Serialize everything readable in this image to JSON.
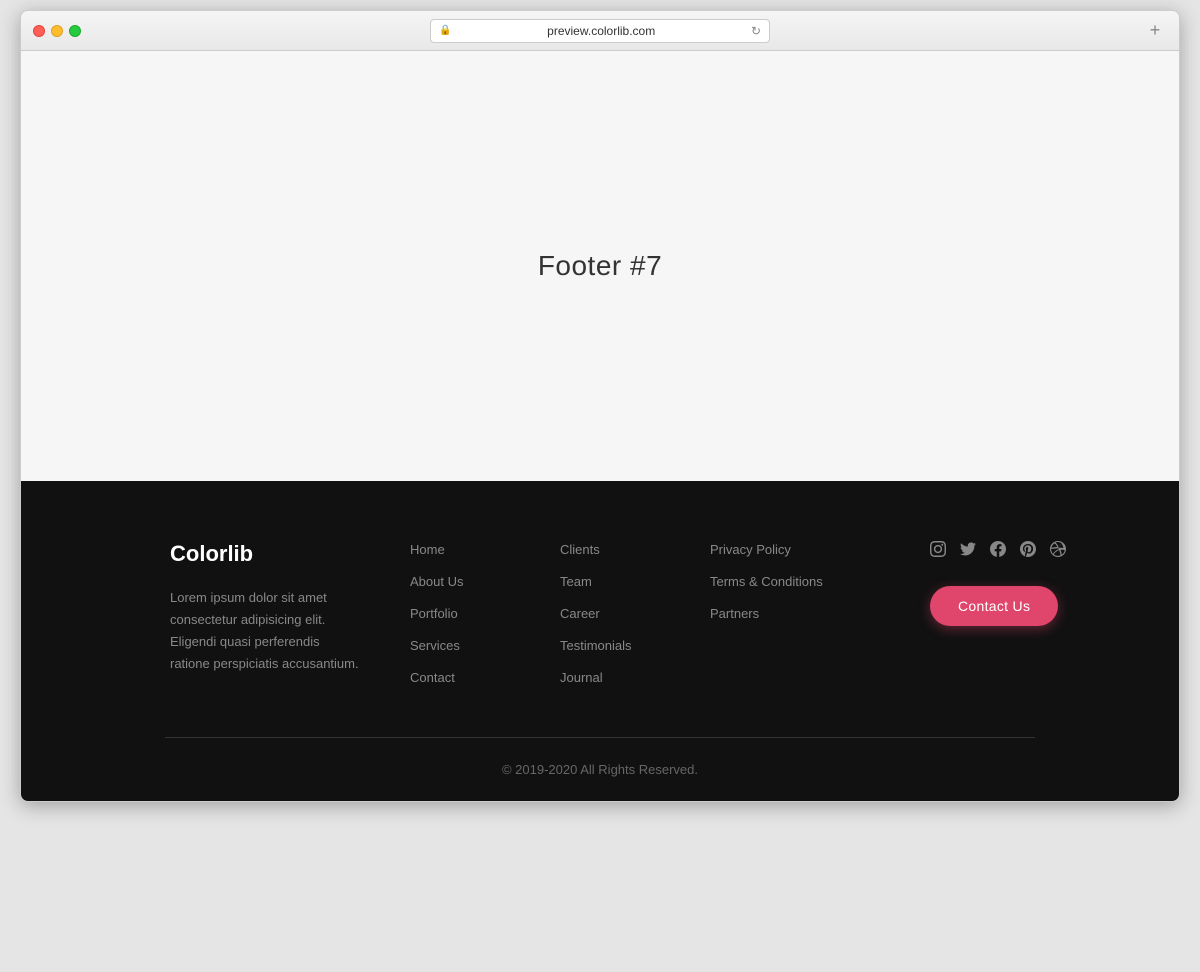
{
  "browser": {
    "url": "preview.colorlib.com",
    "new_tab_icon": "+"
  },
  "main": {
    "title": "Footer #7"
  },
  "footer": {
    "brand": {
      "name": "Colorlib",
      "description": "Lorem ipsum dolor sit amet consectetur adipisicing elit. Eligendi quasi perferendis ratione perspiciatis accusantium."
    },
    "col1": {
      "links": [
        "Home",
        "About Us",
        "Portfolio",
        "Services",
        "Contact"
      ]
    },
    "col2": {
      "links": [
        "Clients",
        "Team",
        "Career",
        "Testimonials",
        "Journal"
      ]
    },
    "col3": {
      "links": [
        "Privacy Policy",
        "Terms & Conditions",
        "Partners"
      ]
    },
    "col4": {
      "contact_btn": "Contact Us"
    },
    "social": {
      "icons": [
        "instagram",
        "twitter",
        "facebook",
        "pinterest",
        "dribbble"
      ]
    },
    "copyright": "© 2019-2020 All Rights Reserved."
  }
}
